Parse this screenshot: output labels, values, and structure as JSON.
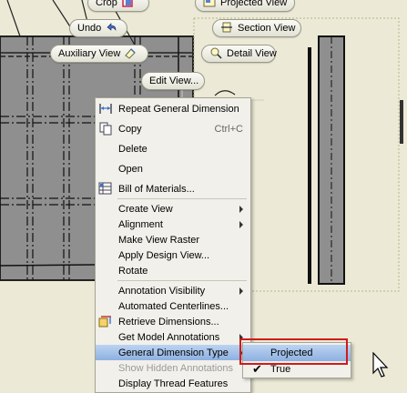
{
  "marking_menu": {
    "crop": "Crop",
    "projected_view": "Projected View",
    "undo": "Undo",
    "section_view": "Section View",
    "auxiliary_view": "Auxiliary View",
    "detail_view": "Detail View",
    "edit_view": "Edit View..."
  },
  "context_menu": {
    "items": [
      {
        "label": "Repeat General Dimension",
        "icon": "dimension-icon"
      },
      {
        "label": "Copy",
        "shortcut": "Ctrl+C",
        "icon": "copy-icon"
      },
      {
        "label": "Delete"
      },
      {
        "label": "Open"
      },
      {
        "label": "Bill of Materials...",
        "icon": "bom-icon"
      },
      {
        "label": "Create View",
        "submenu": true
      },
      {
        "label": "Alignment",
        "submenu": true
      },
      {
        "label": "Make View Raster"
      },
      {
        "label": "Apply Design View..."
      },
      {
        "label": "Rotate"
      },
      {
        "label": "Annotation Visibility",
        "submenu": true
      },
      {
        "label": "Automated Centerlines..."
      },
      {
        "label": "Retrieve Dimensions...",
        "icon": "retrieve-dimensions-icon"
      },
      {
        "label": "Get Model Annotations",
        "submenu": true
      },
      {
        "label": "General Dimension Type",
        "submenu": true,
        "highlighted": true
      },
      {
        "label": "Show Hidden Annotations",
        "disabled": true
      },
      {
        "label": "Display Thread Features"
      }
    ]
  },
  "submenu": {
    "items": [
      {
        "label": "Projected",
        "highlighted": true
      },
      {
        "label": "True",
        "checked": true
      }
    ]
  },
  "colors": {
    "background": "#ecead6",
    "highlight": "#8db0e0",
    "callout": "#d11a1a"
  }
}
